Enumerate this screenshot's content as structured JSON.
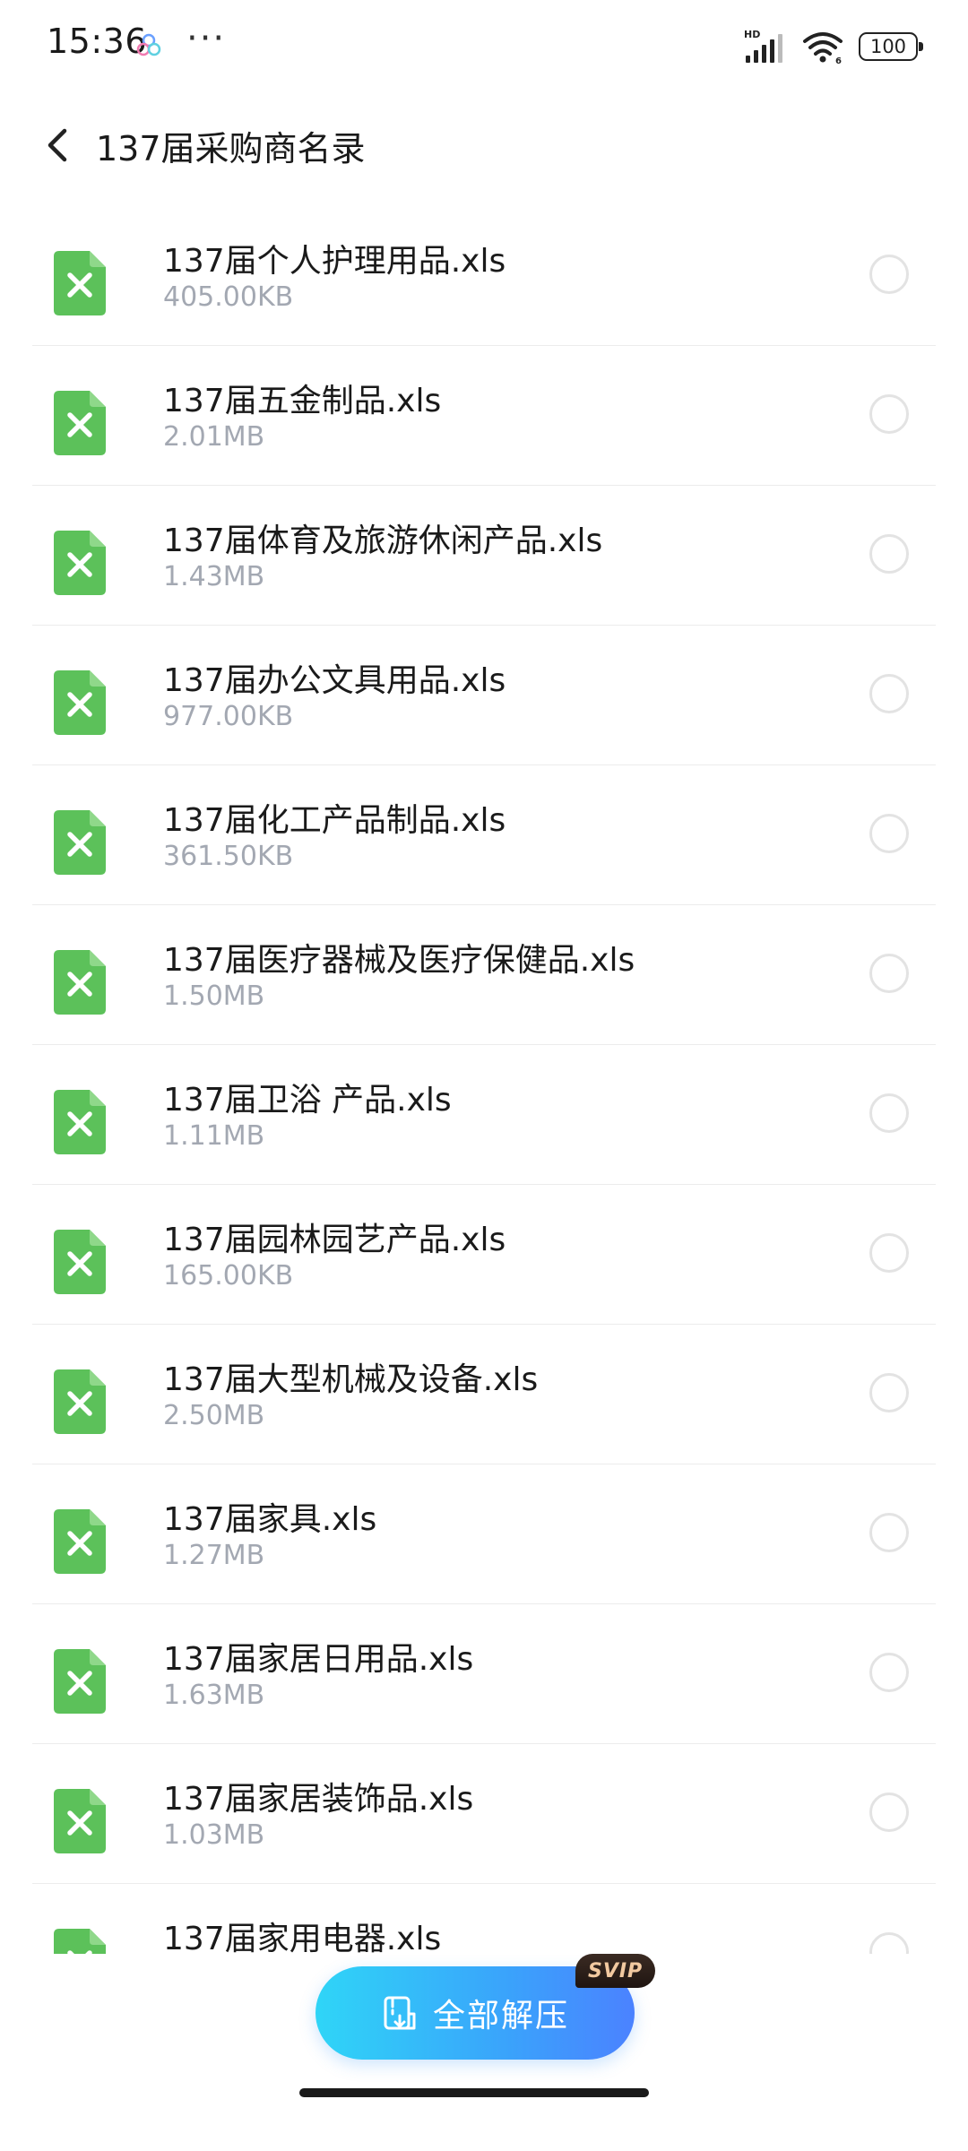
{
  "status_bar": {
    "time": "15:36",
    "dots": "···",
    "battery": "100",
    "network": "HD",
    "wifi": "6"
  },
  "header": {
    "title": "137届采购商名录"
  },
  "files": [
    {
      "name": "137届个人护理用品.xls",
      "size": "405.00KB"
    },
    {
      "name": "137届五金制品.xls",
      "size": "2.01MB"
    },
    {
      "name": "137届体育及旅游休闲产品.xls",
      "size": "1.43MB"
    },
    {
      "name": "137届办公文具用品.xls",
      "size": "977.00KB"
    },
    {
      "name": "137届化工产品制品.xls",
      "size": "361.50KB"
    },
    {
      "name": "137届医疗器械及医疗保健品.xls",
      "size": "1.50MB"
    },
    {
      "name": "137届卫浴 产品.xls",
      "size": "1.11MB"
    },
    {
      "name": "137届园林园艺产品.xls",
      "size": "165.00KB"
    },
    {
      "name": "137届大型机械及设备.xls",
      "size": "2.50MB"
    },
    {
      "name": "137届家具.xls",
      "size": "1.27MB"
    },
    {
      "name": "137届家居日用品.xls",
      "size": "1.63MB"
    },
    {
      "name": "137届家居装饰品.xls",
      "size": "1.03MB"
    },
    {
      "name": "137届家用电器.xls",
      "size": ""
    }
  ],
  "extract_button": {
    "label": "全部解压",
    "badge": "SVIP"
  },
  "icons": {
    "file": "excel-file-icon",
    "back": "chevron-left-icon",
    "extract": "extract-archive-icon"
  },
  "colors": {
    "excel_green": "#5cc15a",
    "accent_start": "#2fd5f7",
    "accent_end": "#4b82ff",
    "size_text": "#a3a8b2"
  }
}
